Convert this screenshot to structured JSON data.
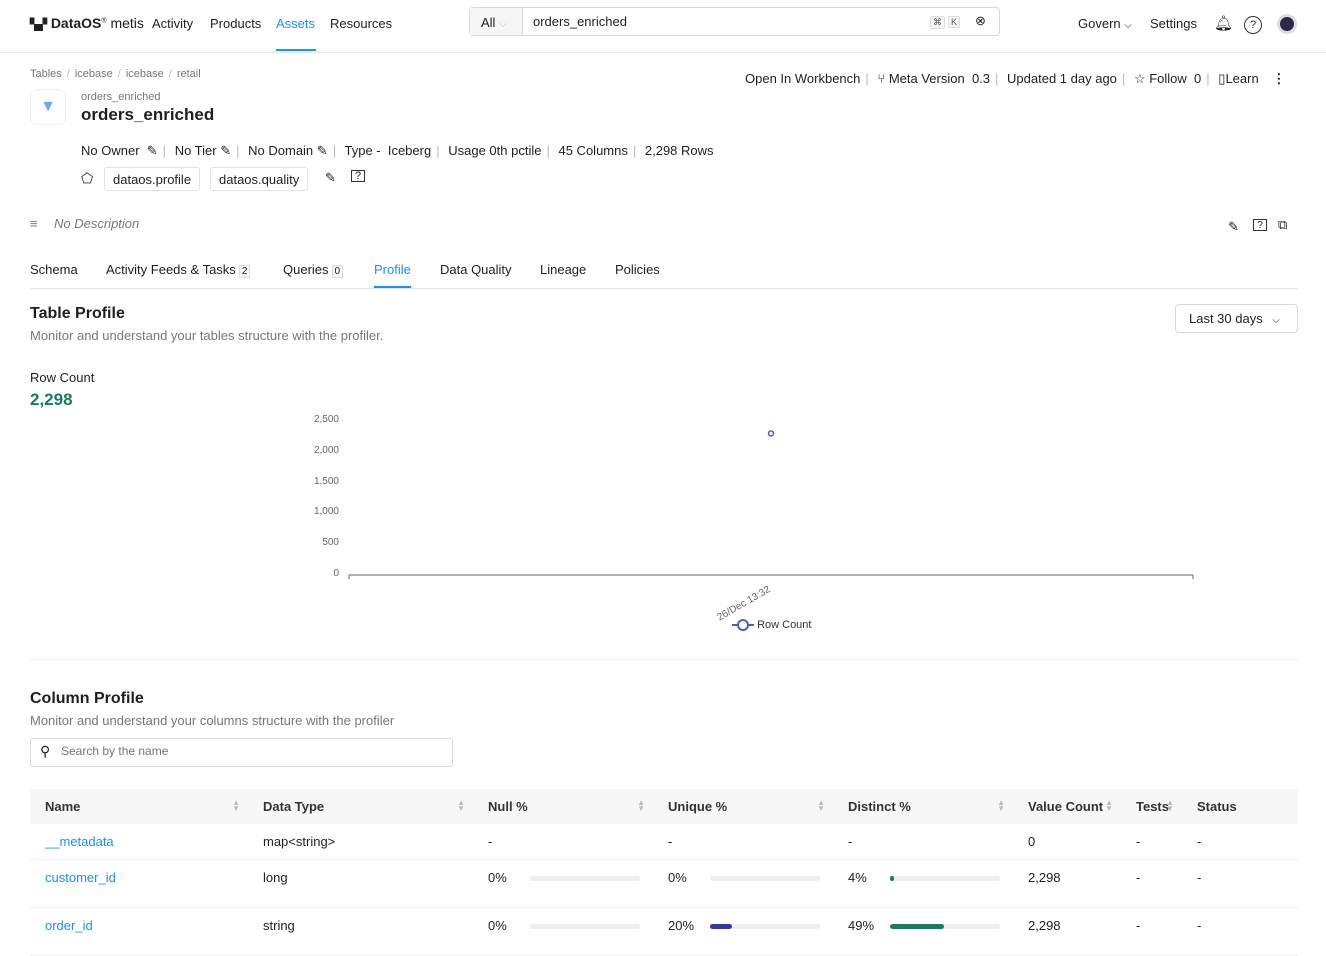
{
  "header": {
    "logo": "DataOS",
    "logo_sub": "metis",
    "nav": [
      "Activity",
      "Products",
      "Assets",
      "Resources"
    ],
    "active_nav": "Assets",
    "search_scope": "All",
    "search_value": "orders_enriched",
    "kbd1": "⌘",
    "kbd2": "K",
    "govern": "Govern",
    "settings": "Settings"
  },
  "breadcrumb": [
    "Tables",
    "icebase",
    "icebase",
    "retail"
  ],
  "asset": {
    "subtitle": "orders_enriched",
    "title": "orders_enriched",
    "owner": "No Owner",
    "tier": "No Tier",
    "domain": "No Domain",
    "type_label": "Type -",
    "type": "Iceberg",
    "usage": "Usage 0th pctile",
    "columns": "45 Columns",
    "rows": "2,298 Rows",
    "tags": [
      "dataos.profile",
      "dataos.quality"
    ],
    "description": "No Description"
  },
  "actions": {
    "workbench": "Open In Workbench",
    "meta_version_label": "Meta Version",
    "meta_version": "0.3",
    "updated": "Updated 1 day ago",
    "follow": "Follow",
    "follow_count": "0",
    "learn": "Learn"
  },
  "tabs": [
    {
      "label": "Schema"
    },
    {
      "label": "Activity Feeds & Tasks",
      "count": "2"
    },
    {
      "label": "Queries",
      "count": "0"
    },
    {
      "label": "Profile"
    },
    {
      "label": "Data Quality"
    },
    {
      "label": "Lineage"
    },
    {
      "label": "Policies"
    }
  ],
  "active_tab": "Profile",
  "table_profile": {
    "title": "Table Profile",
    "subtitle": "Monitor and understand your tables structure with the profiler.",
    "range": "Last 30 days",
    "row_count_label": "Row Count",
    "row_count": "2,298"
  },
  "chart_data": {
    "type": "line",
    "x": [
      "26/Dec 13:32"
    ],
    "series": [
      {
        "name": "Row Count",
        "values": [
          2298
        ],
        "color": "#4a5fc1"
      }
    ],
    "yticks": [
      "0",
      "500",
      "1,000",
      "1,500",
      "2,000",
      "2,500"
    ],
    "ylim": [
      0,
      2500
    ],
    "legend": "bottom"
  },
  "column_profile": {
    "title": "Column Profile",
    "subtitle": "Monitor and understand your columns structure with the profiler",
    "search_placeholder": "Search by the name",
    "headers": [
      "Name",
      "Data Type",
      "Null %",
      "Unique %",
      "Distinct %",
      "Value Count",
      "Tests",
      "Status"
    ],
    "rows": [
      {
        "name": "__metadata",
        "type": "map<string>",
        "null": "-",
        "unique": "-",
        "distinct": "-",
        "value_count": "0",
        "tests": "-",
        "status": "-"
      },
      {
        "name": "customer_id",
        "type": "long",
        "null": "0%",
        "null_v": 0,
        "unique": "0%",
        "unique_v": 0,
        "distinct": "4%",
        "distinct_v": 4,
        "value_count": "2,298",
        "tests": "-",
        "status": "-"
      },
      {
        "name": "order_id",
        "type": "string",
        "null": "0%",
        "null_v": 0,
        "unique": "20%",
        "unique_v": 20,
        "distinct": "49%",
        "distinct_v": 49,
        "value_count": "2,298",
        "tests": "-",
        "status": "-"
      }
    ]
  },
  "colors": {
    "accent": "#1890ff",
    "unique_bar": "#3538a6",
    "distinct_bar": "#1a7a62",
    "row_count": "#1a7a62"
  }
}
